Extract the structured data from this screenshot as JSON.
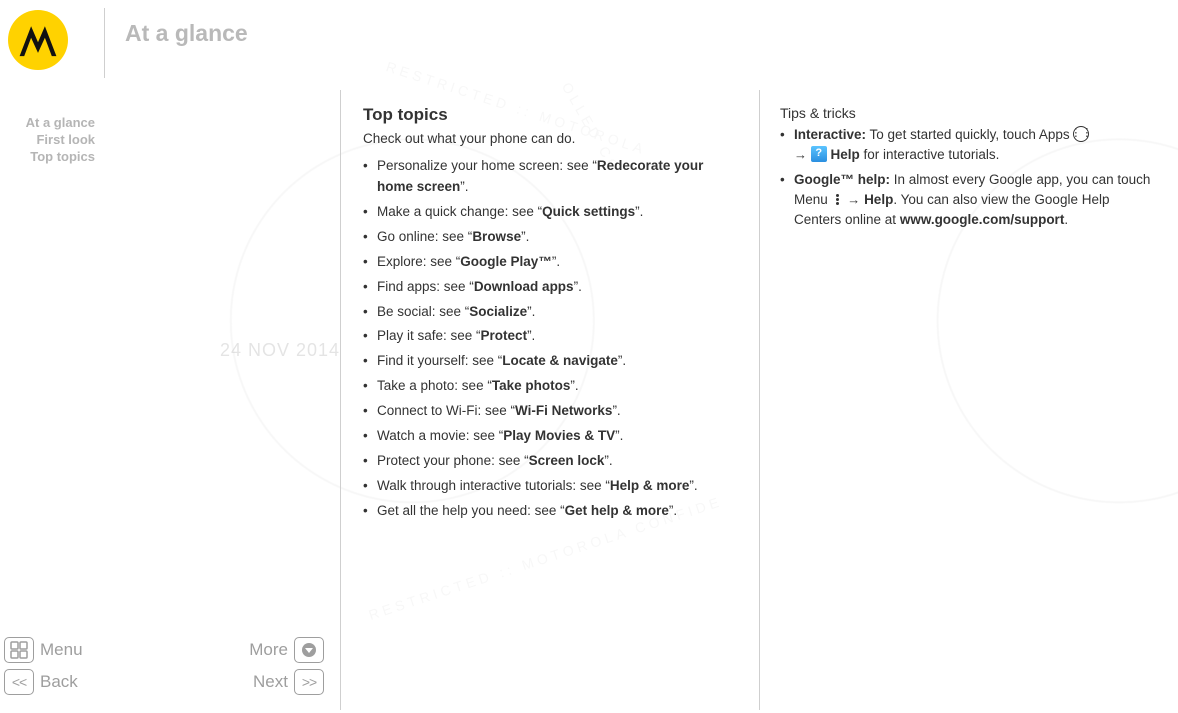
{
  "watermark_date": "24 NOV 2014",
  "page_title": "At a glance",
  "sidebar": {
    "items": [
      "At a glance",
      "First look",
      "Top topics"
    ]
  },
  "main": {
    "heading": "Top topics",
    "intro": "Check out what your phone can do.",
    "items": [
      {
        "prefix": "Personalize your home screen: see “",
        "bold": "Redecorate your home screen",
        "suffix": "”."
      },
      {
        "prefix": "Make a quick change: see “",
        "bold": "Quick settings",
        "suffix": "”."
      },
      {
        "prefix": "Go online: see “",
        "bold": "Browse",
        "suffix": "”."
      },
      {
        "prefix": "Explore: see “",
        "bold": "Google Play™",
        "suffix": "”."
      },
      {
        "prefix": "Find apps: see “",
        "bold": "Download apps",
        "suffix": "”."
      },
      {
        "prefix": "Be social: see “",
        "bold": "Socialize",
        "suffix": "”."
      },
      {
        "prefix": "Play it safe: see “",
        "bold": "Protect",
        "suffix": "”."
      },
      {
        "prefix": "Find it yourself: see “",
        "bold": "Locate & navigate",
        "suffix": "”."
      },
      {
        "prefix": "Take a photo: see “",
        "bold": "Take photos",
        "suffix": "”."
      },
      {
        "prefix": "Connect to Wi-Fi: see “",
        "bold": "Wi-Fi Networks",
        "suffix": "”."
      },
      {
        "prefix": "Watch a movie: see “",
        "bold": "Play Movies & TV",
        "suffix": "”."
      },
      {
        "prefix": "Protect your phone: see “",
        "bold": "Screen lock",
        "suffix": "”."
      },
      {
        "prefix": "Walk through interactive tutorials: see “",
        "bold": "Help & more",
        "suffix": "”."
      },
      {
        "prefix": "Get all the help you need: see “",
        "bold": "Get help & more",
        "suffix": "”."
      }
    ]
  },
  "tips": {
    "heading": "Tips & tricks",
    "item1": {
      "bold_lead": "Interactive:",
      "part1": " To get started quickly, touch Apps ",
      "arrow": "→",
      "help_word": " Help",
      "part2": " for interactive tutorials."
    },
    "item2": {
      "bold_lead": "Google™ help:",
      "part1": " In almost every Google app, you can touch Menu ",
      "arrow": "→",
      "help_word": " Help",
      "part2": ". You can also view the Google Help Centers online at ",
      "url": "www.google.com/support",
      "end": "."
    }
  },
  "bottom_nav": {
    "menu": "Menu",
    "more": "More",
    "back": "Back",
    "next": "Next"
  }
}
